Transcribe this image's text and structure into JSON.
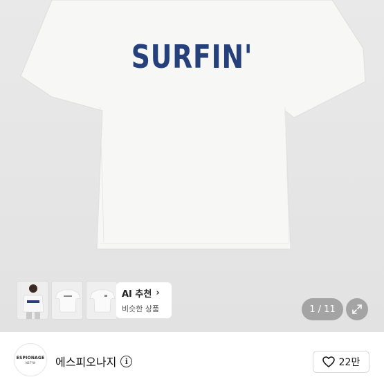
{
  "product_image": {
    "print_text": "SURFIN'",
    "colors": {
      "background": "#e6e6e6",
      "shirt": "#f7f7f5",
      "print": "#25407a"
    }
  },
  "thumbnails": [
    {
      "name": "model-photo"
    },
    {
      "name": "tee-front"
    },
    {
      "name": "tee-back"
    }
  ],
  "ai_recommend": {
    "title": "AI 추천",
    "subtitle": "비슷한 상품",
    "chevron": "›"
  },
  "gallery": {
    "counter": "1 / 11",
    "expand_icon": "expand-icon"
  },
  "seller": {
    "logo_text": "ESPIONAGE",
    "logo_sub": "N37°W",
    "name": "에스피오나지",
    "info_icon": "i"
  },
  "like": {
    "count": "22만",
    "icon": "heart-icon"
  }
}
